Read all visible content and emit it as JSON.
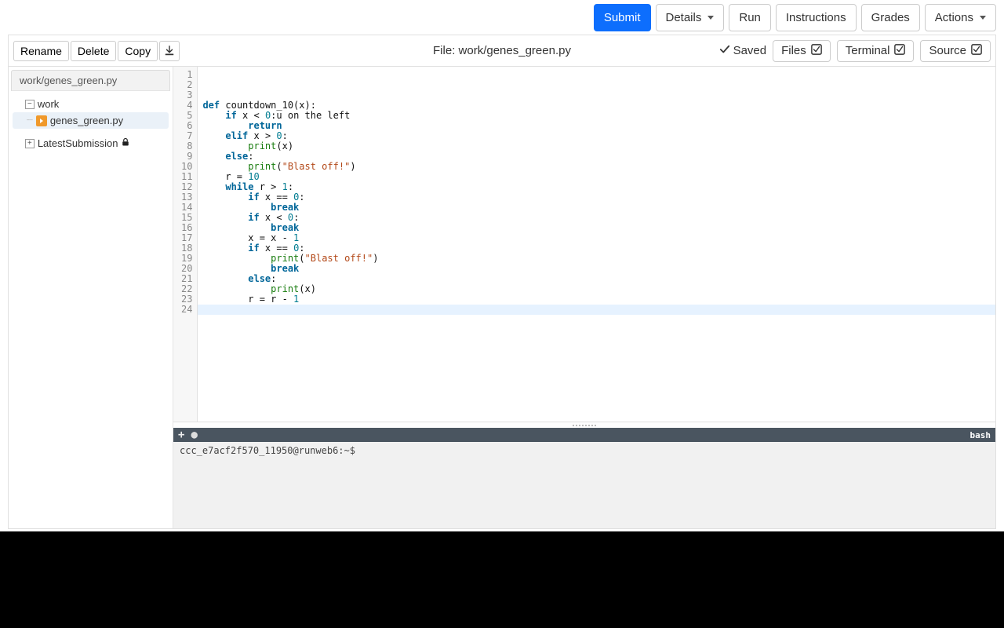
{
  "topbar": {
    "submit": "Submit",
    "details": "Details",
    "run": "Run",
    "instructions": "Instructions",
    "grades": "Grades",
    "actions": "Actions"
  },
  "file_toolbar": {
    "rename": "Rename",
    "delete": "Delete",
    "copy": "Copy",
    "title_prefix": "File: ",
    "title_path": "work/genes_green.py",
    "saved": "Saved",
    "files": "Files",
    "terminal": "Terminal",
    "source": "Source"
  },
  "tree": {
    "tab": "work/genes_green.py",
    "folder": "work",
    "file": "genes_green.py",
    "latest": "LatestSubmission"
  },
  "code_lines": [
    "",
    "",
    "",
    {
      "kw": "def",
      "rest": " countdown_10(x):"
    },
    {
      "indent": "    ",
      "kw": "if",
      "rest": " x < ",
      "num": "0",
      "tail": ":u on the left"
    },
    {
      "indent": "        ",
      "kw": "return"
    },
    {
      "indent": "    ",
      "kw": "elif",
      "rest": " x > ",
      "num": "0",
      "tail": ":"
    },
    {
      "indent": "        ",
      "fn": "print",
      "rest": "(x)"
    },
    {
      "indent": "    ",
      "kw": "else",
      "tail": ":"
    },
    {
      "indent": "        ",
      "fn": "print",
      "rest": "(",
      "str": "\"Blast off!\"",
      "rest2": ")"
    },
    {
      "indent": "    ",
      "rest": "r = ",
      "num": "10"
    },
    {
      "indent": "    ",
      "kw": "while",
      "rest": " r > ",
      "num": "1",
      "tail": ":"
    },
    {
      "indent": "        ",
      "kw": "if",
      "rest": " x == ",
      "num": "0",
      "tail": ":"
    },
    {
      "indent": "            ",
      "kw": "break"
    },
    {
      "indent": "        ",
      "kw": "if",
      "rest": " x < ",
      "num": "0",
      "tail": ":"
    },
    {
      "indent": "            ",
      "kw": "break"
    },
    {
      "indent": "        ",
      "rest": "x = x - ",
      "num": "1"
    },
    {
      "indent": "        ",
      "kw": "if",
      "rest": " x == ",
      "num": "0",
      "tail": ":"
    },
    {
      "indent": "            ",
      "fn": "print",
      "rest": "(",
      "str": "\"Blast off!\"",
      "rest2": ")"
    },
    {
      "indent": "            ",
      "kw": "break"
    },
    {
      "indent": "        ",
      "kw": "else",
      "tail": ":"
    },
    {
      "indent": "            ",
      "fn": "print",
      "rest": "(x)"
    },
    {
      "indent": "        ",
      "rest": "r = r - ",
      "num": "1"
    },
    ""
  ],
  "terminal": {
    "shell": "bash",
    "prompt": "ccc_e7acf2f570_11950@runweb6:~$"
  }
}
